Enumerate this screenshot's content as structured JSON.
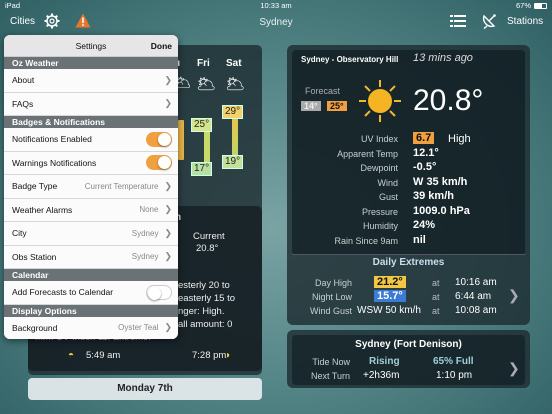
{
  "status": {
    "carrier": "iPad",
    "time": "10:33 am",
    "battery": "67%"
  },
  "nav": {
    "cities": "Cities",
    "title": "Sydney",
    "stations": "Stations"
  },
  "left": {
    "days": [
      "u",
      "Fri",
      "Sat"
    ],
    "fri_high": "25°",
    "fri_low": "17°",
    "sat_high": "29°",
    "sat_low": "19°",
    "h_label": "h",
    "current_label": "Current",
    "current_value": "20.8°",
    "text_lines": [
      "esterly 20 to",
      "easterly 15 to",
      "nger: High.",
      "all amount: 0",
      "mm. UV Index 11: Extreme."
    ],
    "sunrise": "5:49 am",
    "sunset": "7:28 pm",
    "next_day": "Monday 7th"
  },
  "settings": {
    "title": "Settings",
    "done": "Done",
    "sections": {
      "oz": "Oz Weather",
      "badges": "Badges & Notifications",
      "calendar": "Calendar",
      "display": "Display Options"
    },
    "rows": {
      "about": "About",
      "faqs": "FAQs",
      "notif": "Notifications Enabled",
      "warn": "Warnings Notifications",
      "badge_type": "Badge Type",
      "badge_type_val": "Current Temperature",
      "alarms": "Weather Alarms",
      "alarms_val": "None",
      "city": "City",
      "city_val": "Sydney",
      "obs": "Obs Station",
      "obs_val": "Sydney",
      "addcal": "Add Forecasts to Calendar",
      "bg": "Background",
      "bg_val": "Oyster Teal"
    }
  },
  "obs": {
    "station": "Sydney - Observatory Hill",
    "ago": "13 mins ago",
    "forecast_label": "Forecast",
    "fc_low": "14°",
    "fc_high": "25°",
    "temp": "20.8°",
    "labels": [
      "UV Index",
      "Apparent Temp",
      "Dewpoint",
      "Wind",
      "Gust",
      "Pressure",
      "Humidity",
      "Rain Since 9am"
    ],
    "uv_value": "6.7",
    "uv_text": "High",
    "values": [
      "12.1°",
      "-0.5°",
      "W 35 km/h",
      "39 km/h",
      "1009.0 hPa",
      "24%",
      "nil"
    ]
  },
  "extremes": {
    "title": "Daily Extremes",
    "labels": [
      "Day High",
      "Night Low",
      "Wind Gust"
    ],
    "values": [
      "21.2°",
      "15.7°",
      "WSW 50 km/h"
    ],
    "at": "at",
    "times": [
      "10:16 am",
      "6:44 am",
      "10:08 am"
    ]
  },
  "tide": {
    "title": "Sydney (Fort Denison)",
    "now_label": "Tide Now",
    "now_value": "Rising",
    "moon": "65% Full",
    "next_label": "Next Turn",
    "next_value": "+2h36m",
    "next_time": "1:10 pm"
  },
  "colors": {
    "orange": "#f0a040",
    "blue": "#3a7bd5",
    "yellow": "#f2c744"
  }
}
